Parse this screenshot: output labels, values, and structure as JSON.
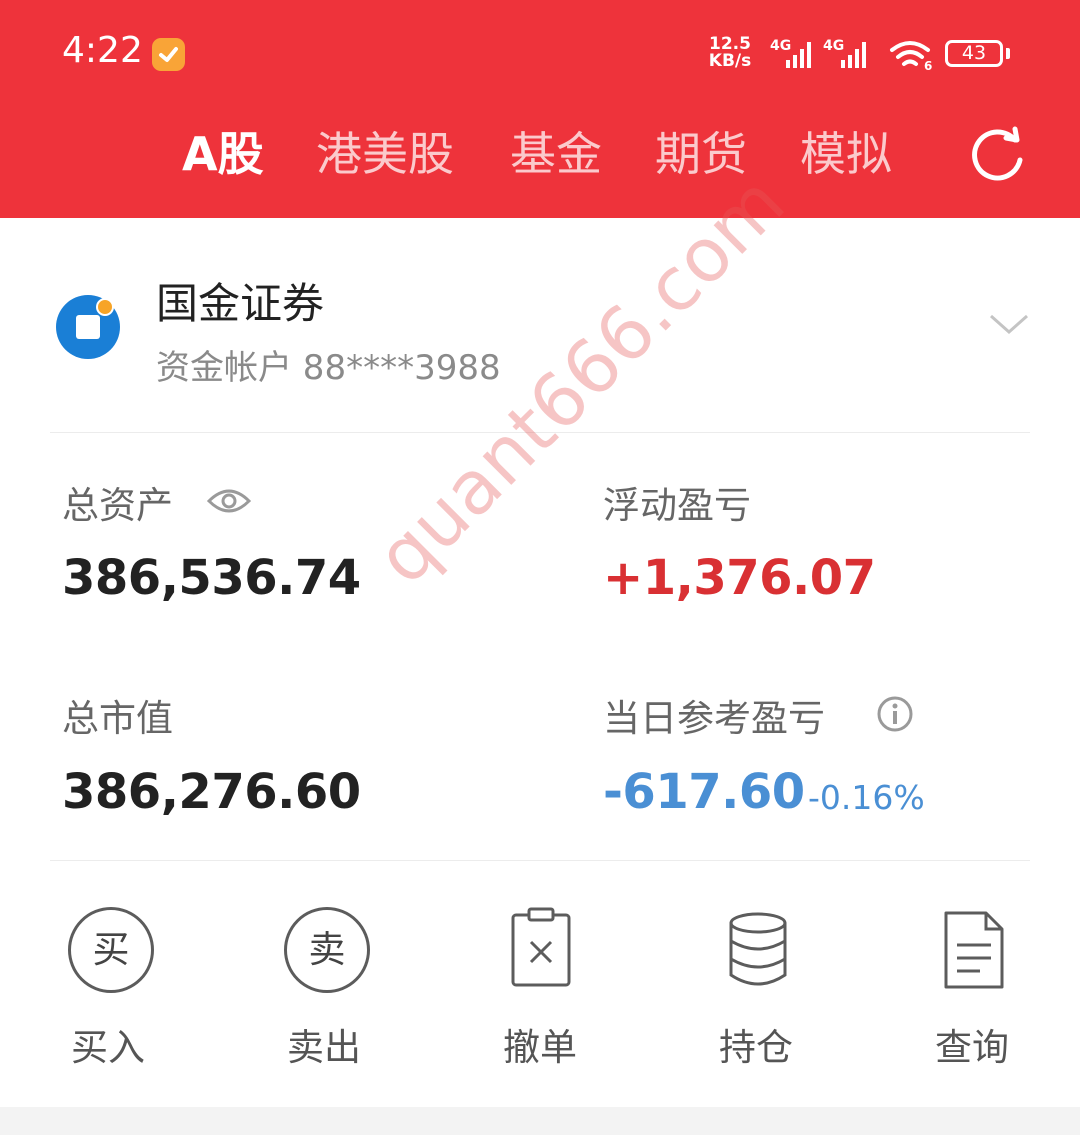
{
  "status_bar": {
    "time": "4:22",
    "net_speed_value": "12.5",
    "net_speed_unit": "KB/s",
    "sim1_label": "4G",
    "sim2_label": "4G",
    "wifi_label": "6",
    "battery": "43"
  },
  "tabs": [
    {
      "label": "A股",
      "active": true
    },
    {
      "label": "港美股",
      "active": false
    },
    {
      "label": "基金",
      "active": false
    },
    {
      "label": "期货",
      "active": false
    },
    {
      "label": "模拟",
      "active": false
    }
  ],
  "account": {
    "broker": "国金证券",
    "account_line": "资金帐户 88****3988"
  },
  "summary": {
    "total_assets_label": "总资产",
    "total_assets_value": "386,536.74",
    "floating_pl_label": "浮动盈亏",
    "floating_pl_value": "+1,376.07",
    "market_value_label": "总市值",
    "market_value_value": "386,276.60",
    "daily_pl_label": "当日参考盈亏",
    "daily_pl_value": "-617.60",
    "daily_pl_pct": "-0.16%"
  },
  "actions": [
    {
      "label": "买入",
      "glyph": "买",
      "icon": "buy-icon"
    },
    {
      "label": "卖出",
      "glyph": "卖",
      "icon": "sell-icon"
    },
    {
      "label": "撤单",
      "icon": "cancel-order-icon"
    },
    {
      "label": "持仓",
      "icon": "positions-icon"
    },
    {
      "label": "查询",
      "icon": "query-icon"
    }
  ],
  "watermark": "quant666.com",
  "colors": {
    "header": "#ee333b",
    "profit": "#d93033",
    "loss": "#4a8fd4",
    "broker_logo": "#1a7fd6"
  }
}
